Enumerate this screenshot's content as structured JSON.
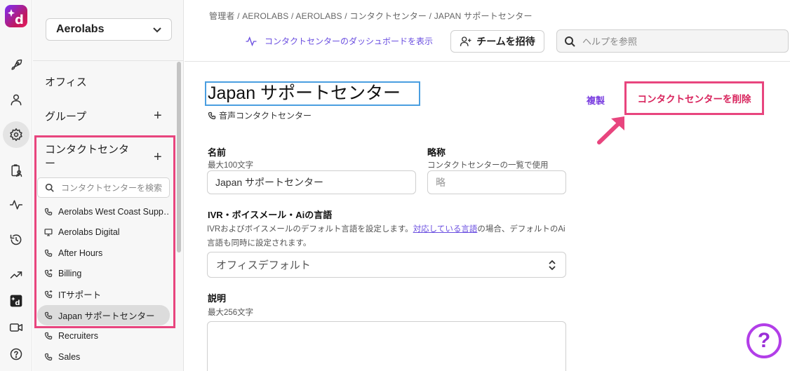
{
  "header": {
    "breadcrumb": "管理者 / AEROLABS / AEROLABS / コンタクトセンター / JAPAN サポートセンター",
    "dashboard_link": "コンタクトセンターのダッシュボードを表示",
    "invite_button": "チームを招待",
    "help_search_placeholder": "ヘルプを参照"
  },
  "sidebar": {
    "org_name": "Aerolabs",
    "offices_label": "オフィス",
    "groups_label": "グループ",
    "contact_centers_label": "コンタクトセンタ\nー",
    "search_placeholder": "コンタクトセンターを検索",
    "contact_centers": [
      {
        "label": "Aerolabs West Coast Supp…",
        "icon": "phone-icon"
      },
      {
        "label": "Aerolabs Digital",
        "icon": "monitor-icon"
      },
      {
        "label": "After Hours",
        "icon": "phone-icon"
      },
      {
        "label": "Billing",
        "icon": "phone-forward-icon"
      },
      {
        "label": "ITサポート",
        "icon": "phone-forward-icon"
      },
      {
        "label": "Japan サポートセンター",
        "icon": "phone-icon",
        "selected": true
      },
      {
        "label": "Recruiters",
        "icon": "phone-icon"
      },
      {
        "label": "Sales",
        "icon": "phone-icon"
      }
    ]
  },
  "main": {
    "title": "Japan サポートセンター",
    "subtype": "音声コンタクトセンター",
    "duplicate_label": "複製",
    "delete_label": "コンタクトセンターを削除",
    "name_label": "名前",
    "name_hint": "最大100文字",
    "name_value": "Japan サポートセンター",
    "abbr_label": "略称",
    "abbr_hint": "コンタクトセンターの一覧で使用",
    "abbr_placeholder": "略",
    "lang_label": "IVR・ボイスメール・Aiの言語",
    "lang_desc_before": "IVRおよびボイスメールのデフォルト言語を設定します。",
    "lang_desc_link": "対応している言語",
    "lang_desc_after": "の場合、デフォルトのAi言語も同時に設定されます。",
    "lang_value": "オフィスデフォルト",
    "description_label": "説明",
    "description_hint": "最大256文字"
  },
  "help_fab": "?",
  "colors": {
    "accent": "#6a4ee0",
    "highlight": "#e8457e",
    "delete_text": "#d8245d",
    "focus_border": "#4a9ee0"
  }
}
